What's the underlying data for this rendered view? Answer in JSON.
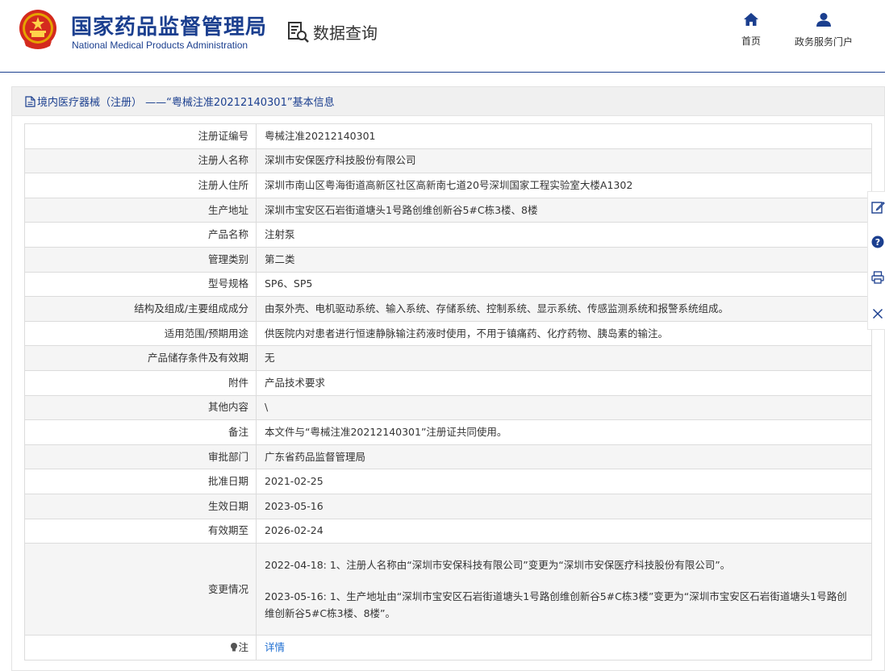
{
  "header": {
    "brand_cn": "国家药品监督管理局",
    "brand_en": "National Medical Products Administration",
    "query_title": "数据查询",
    "nav": [
      {
        "label": "首页",
        "icon": "home-icon"
      },
      {
        "label": "政务服务门户",
        "icon": "user-icon"
      }
    ]
  },
  "panel": {
    "title": "境内医疗器械（注册） ——“粤械注准20212140301”基本信息"
  },
  "fields": [
    {
      "label": "注册证编号",
      "value": "粤械注准20212140301"
    },
    {
      "label": "注册人名称",
      "value": "深圳市安保医疗科技股份有限公司"
    },
    {
      "label": "注册人住所",
      "value": "深圳市南山区粤海街道高新区社区高新南七道20号深圳国家工程实验室大楼A1302"
    },
    {
      "label": "生产地址",
      "value": "深圳市宝安区石岩街道塘头1号路创维创新谷5#C栋3楼、8楼"
    },
    {
      "label": "产品名称",
      "value": "注射泵"
    },
    {
      "label": "管理类别",
      "value": "第二类"
    },
    {
      "label": "型号规格",
      "value": "SP6、SP5"
    },
    {
      "label": "结构及组成/主要组成成分",
      "value": "由泵外壳、电机驱动系统、输入系统、存储系统、控制系统、显示系统、传感监测系统和报警系统组成。"
    },
    {
      "label": "适用范围/预期用途",
      "value": "供医院内对患者进行恒速静脉输注药液时使用，不用于镇痛药、化疗药物、胰岛素的输注。"
    },
    {
      "label": "产品储存条件及有效期",
      "value": "无"
    },
    {
      "label": "附件",
      "value": "产品技术要求"
    },
    {
      "label": "其他内容",
      "value": "\\"
    },
    {
      "label": "备注",
      "value": "本文件与“粤械注准20212140301”注册证共同使用。"
    },
    {
      "label": "审批部门",
      "value": "广东省药品监督管理局"
    },
    {
      "label": "批准日期",
      "value": "2021-02-25"
    },
    {
      "label": "生效日期",
      "value": "2023-05-16"
    },
    {
      "label": "有效期至",
      "value": "2026-02-24"
    }
  ],
  "changes": {
    "label": "变更情况",
    "entries": [
      "2022-04-18: 1、注册人名称由“深圳市安保科技有限公司”变更为“深圳市安保医疗科技股份有限公司”。",
      "2023-05-16: 1、生产地址由“深圳市宝安区石岩街道塘头1号路创维创新谷5#C栋3楼”变更为“深圳市宝安区石岩街道塘头1号路创",
      "维创新谷5#C栋3楼、8楼”。"
    ]
  },
  "note": {
    "label": "注",
    "link": "详情"
  },
  "side_tools": [
    "edit-icon",
    "help-icon",
    "print-icon",
    "close-icon"
  ],
  "colors": {
    "brand": "#1b3f8f",
    "link": "#1b6cd1",
    "zebra": "#f5f5f5"
  }
}
